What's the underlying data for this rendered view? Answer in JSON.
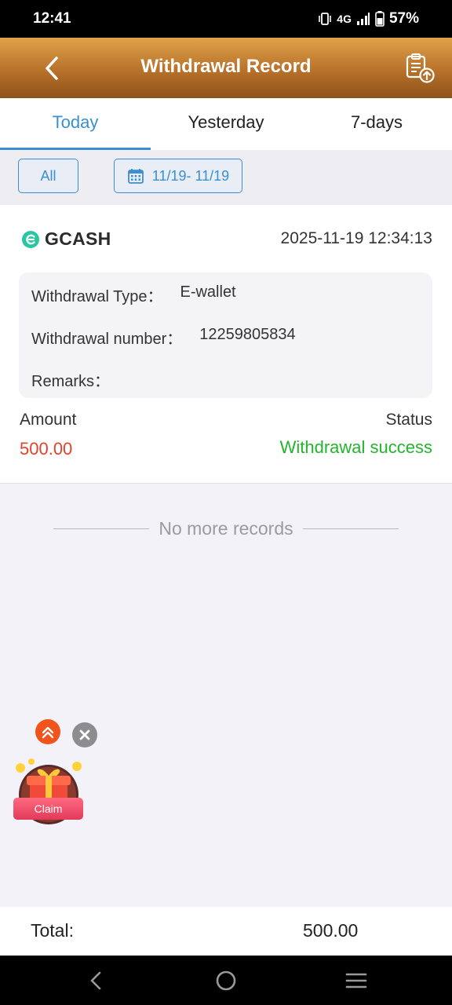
{
  "status_bar": {
    "time": "12:41",
    "network": "4G",
    "battery": "57%"
  },
  "header": {
    "title": "Withdrawal Record"
  },
  "tabs": [
    {
      "label": "Today",
      "active": true
    },
    {
      "label": "Yesterday",
      "active": false
    },
    {
      "label": "7-days",
      "active": false
    }
  ],
  "filters": {
    "all_label": "All",
    "date_range": "11/19- 11/19"
  },
  "record": {
    "method": "GCASH",
    "datetime": "2025-11-19 12:34:13",
    "details": [
      {
        "label": "Withdrawal Type：",
        "value": "E-wallet"
      },
      {
        "label": "Withdrawal number：",
        "value": "12259805834"
      },
      {
        "label": "Remarks：",
        "value": ""
      }
    ],
    "amount_label": "Amount",
    "amount": "500.00",
    "status_label": "Status",
    "status": "Withdrawal success"
  },
  "no_more": "No more records",
  "promo": {
    "claim_label": "Claim"
  },
  "total": {
    "label": "Total:",
    "value": "500.00"
  },
  "colors": {
    "accent": "#3a8fd0",
    "header": "#b7712a",
    "amount": "#e2422a",
    "success": "#22b52c"
  },
  "icons": [
    "back-arrow-icon",
    "upload-record-icon",
    "calendar-icon",
    "gcash-logo-icon",
    "double-chevron-up-icon",
    "close-icon",
    "gift-icon",
    "nav-back-icon",
    "nav-home-icon",
    "nav-menu-icon"
  ]
}
